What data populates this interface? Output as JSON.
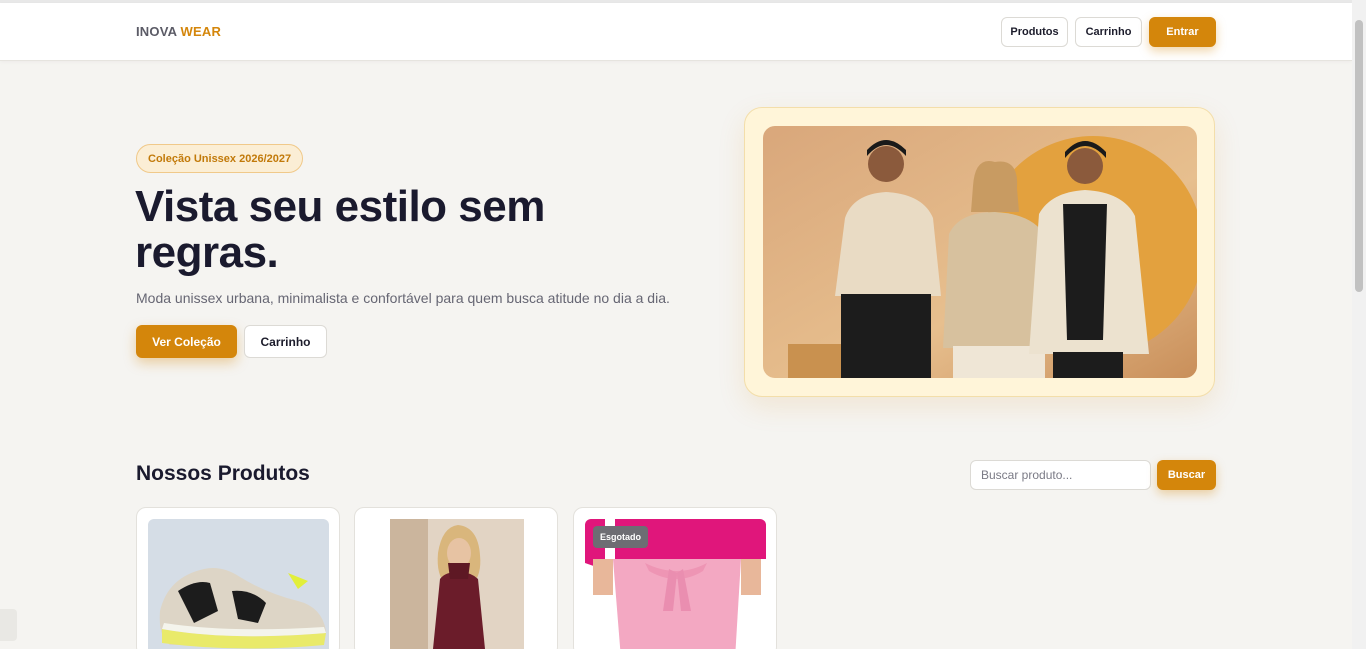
{
  "header": {
    "logo_part1": "INOVA",
    "logo_part2": "WEAR",
    "nav": {
      "produtos": "Produtos",
      "carrinho": "Carrinho",
      "entrar": "Entrar"
    }
  },
  "hero": {
    "badge": "Coleção Unissex 2026/2027",
    "title": "Vista seu estilo sem regras.",
    "subtitle": "Moda unissex urbana, minimalista e confortável para quem busca atitude no dia a dia.",
    "primary_button": "Ver Coleção",
    "secondary_button": "Carrinho"
  },
  "products": {
    "title": "Nossos Produtos",
    "search": {
      "placeholder": "Buscar produto...",
      "button": "Buscar"
    },
    "items": [
      {
        "image": "sneaker"
      },
      {
        "image": "burgundy-knit-dress"
      },
      {
        "image": "pink-skirt",
        "badge": "Esgotado"
      }
    ]
  },
  "colors": {
    "accent": "#d4860b",
    "background": "#f5f4f1",
    "heading": "#1a1a2e",
    "soldout": "#6d6d73"
  }
}
